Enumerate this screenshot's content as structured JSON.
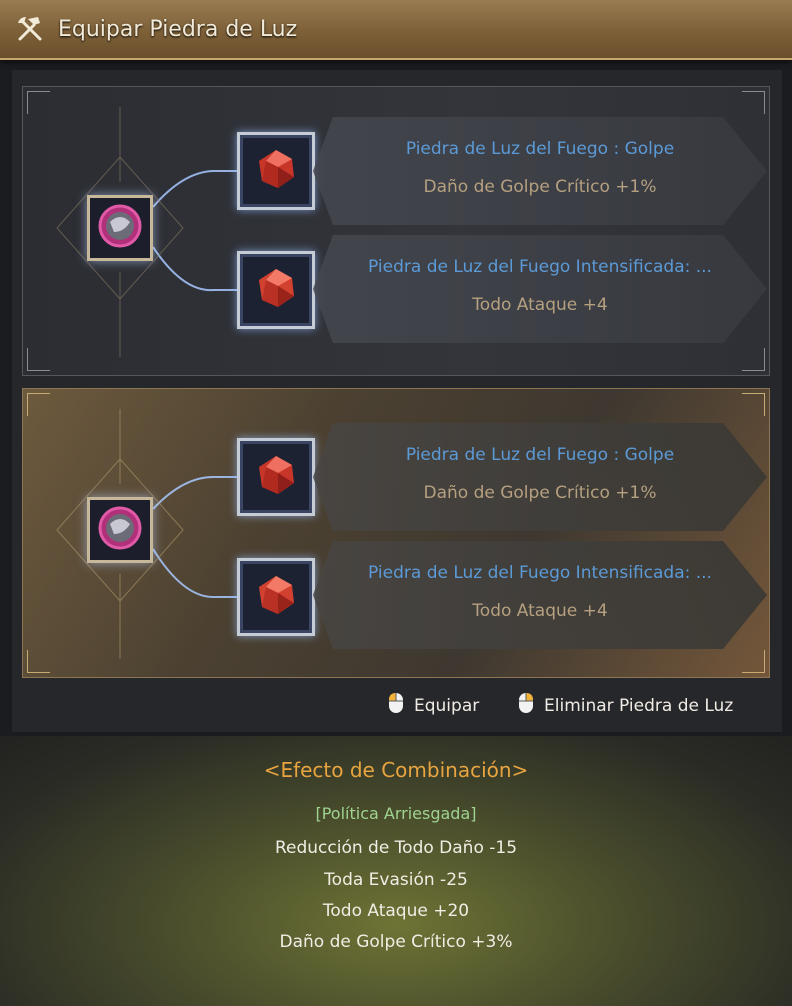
{
  "window": {
    "title": "Equipar Piedra de Luz",
    "icon": "hammer-pick-icon"
  },
  "colors": {
    "title_bar": "#7d6038",
    "gem_name": "#5b9ad6",
    "gem_stat": "#b5a07f",
    "effect_title": "#e8a53f",
    "effect_name": "#9fd38f"
  },
  "sets": [
    {
      "selected": false,
      "gems": [
        {
          "name": "Piedra de Luz del Fuego : Golpe",
          "stat": "Daño de Golpe Crítico +1%"
        },
        {
          "name": "Piedra de Luz del Fuego Intensificada: ...",
          "stat": "Todo Ataque +4"
        }
      ]
    },
    {
      "selected": true,
      "gems": [
        {
          "name": "Piedra de Luz del Fuego : Golpe",
          "stat": "Daño de Golpe Crítico +1%"
        },
        {
          "name": "Piedra de Luz del Fuego Intensificada: ...",
          "stat": "Todo Ataque +4"
        }
      ]
    }
  ],
  "actions": {
    "equip_label": "Equipar",
    "remove_label": "Eliminar Piedra de Luz"
  },
  "combination": {
    "title": "<Efecto de Combinación>",
    "name": "[Política Arriesgada]",
    "effects": [
      "Reducción de Todo Daño -15",
      "Toda Evasión -25",
      "Todo Ataque +20",
      "Daño de Golpe Crítico +3%"
    ]
  }
}
